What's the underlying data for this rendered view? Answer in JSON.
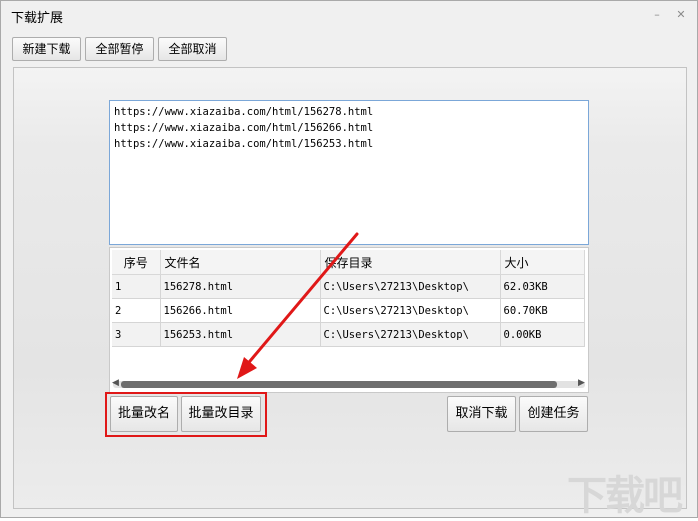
{
  "window": {
    "title": "下载扩展"
  },
  "toolbar": {
    "new_download": "新建下载",
    "pause_all": "全部暂停",
    "cancel_all": "全部取消"
  },
  "urls": [
    "https://www.xiazaiba.com/html/156278.html",
    "https://www.xiazaiba.com/html/156266.html",
    "https://www.xiazaiba.com/html/156253.html"
  ],
  "table": {
    "headers": [
      "序号",
      "文件名",
      "保存目录",
      "大小"
    ],
    "rows": [
      {
        "index": "1",
        "filename": "156278.html",
        "dir": "C:\\Users\\27213\\Desktop\\",
        "size": "62.03KB"
      },
      {
        "index": "2",
        "filename": "156266.html",
        "dir": "C:\\Users\\27213\\Desktop\\",
        "size": "60.70KB"
      },
      {
        "index": "3",
        "filename": "156253.html",
        "dir": "C:\\Users\\27213\\Desktop\\",
        "size": "0.00KB"
      }
    ]
  },
  "actions": {
    "batch_rename": "批量改名",
    "batch_change_dir": "批量改目录",
    "cancel_download": "取消下载",
    "create_task": "创建任务"
  },
  "annotation": {
    "color": "#e01818"
  },
  "watermark": {
    "text": "下载吧"
  },
  "icons": {
    "minimize": "minimize-icon",
    "close": "close-icon"
  }
}
